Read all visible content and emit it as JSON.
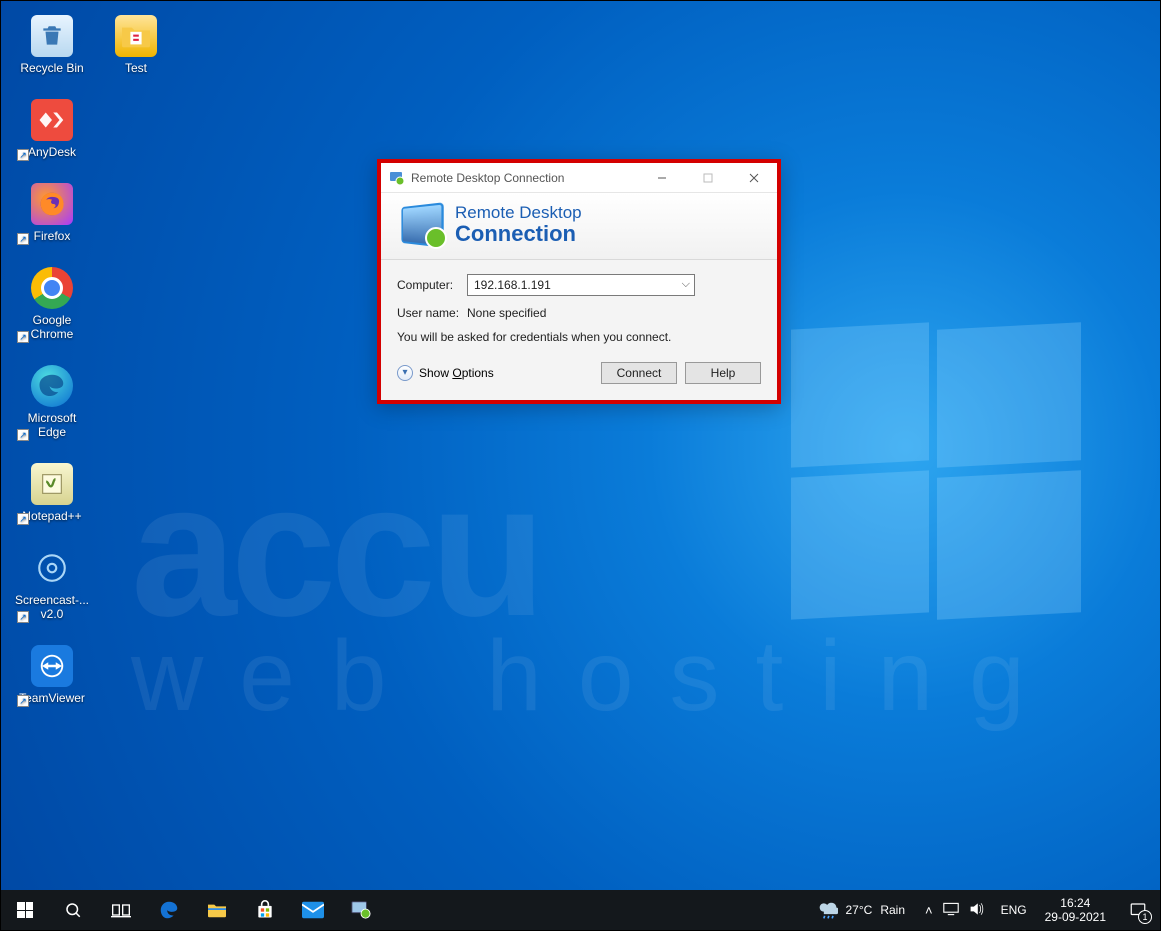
{
  "desktop": {
    "col1": [
      {
        "label": "Recycle Bin",
        "icon": "recycle-bin-icon",
        "shortcut": false
      },
      {
        "label": "AnyDesk",
        "icon": "anydesk-icon",
        "shortcut": true
      },
      {
        "label": "Firefox",
        "icon": "firefox-icon",
        "shortcut": true
      },
      {
        "label": "Google Chrome",
        "icon": "chrome-icon",
        "shortcut": true
      },
      {
        "label": "Microsoft Edge",
        "icon": "edge-icon",
        "shortcut": true
      },
      {
        "label": "Notepad++",
        "icon": "notepadpp-icon",
        "shortcut": true
      },
      {
        "label": "Screencast-... v2.0",
        "icon": "screencast-icon",
        "shortcut": true
      },
      {
        "label": "TeamViewer",
        "icon": "teamviewer-icon",
        "shortcut": true
      }
    ],
    "col2": [
      {
        "label": "Test",
        "icon": "folder-icon",
        "shortcut": false
      }
    ]
  },
  "rdc": {
    "window_title": "Remote Desktop Connection",
    "banner_line1": "Remote Desktop",
    "banner_line2": "Connection",
    "labels": {
      "computer": "Computer:",
      "username": "User name:"
    },
    "computer_value": "192.168.1.191",
    "username_value": "None specified",
    "hint": "You will be asked for credentials when you connect.",
    "show_options": "Show Options",
    "btn_connect": "Connect",
    "btn_help": "Help"
  },
  "taskbar": {
    "weather": {
      "temp": "27°C",
      "text": "Rain"
    },
    "lang": "ENG",
    "clock": {
      "time": "16:24",
      "date": "29-09-2021"
    },
    "notif_count": "1"
  },
  "watermark": {
    "l1": "accu",
    "l2": "web hosting"
  }
}
